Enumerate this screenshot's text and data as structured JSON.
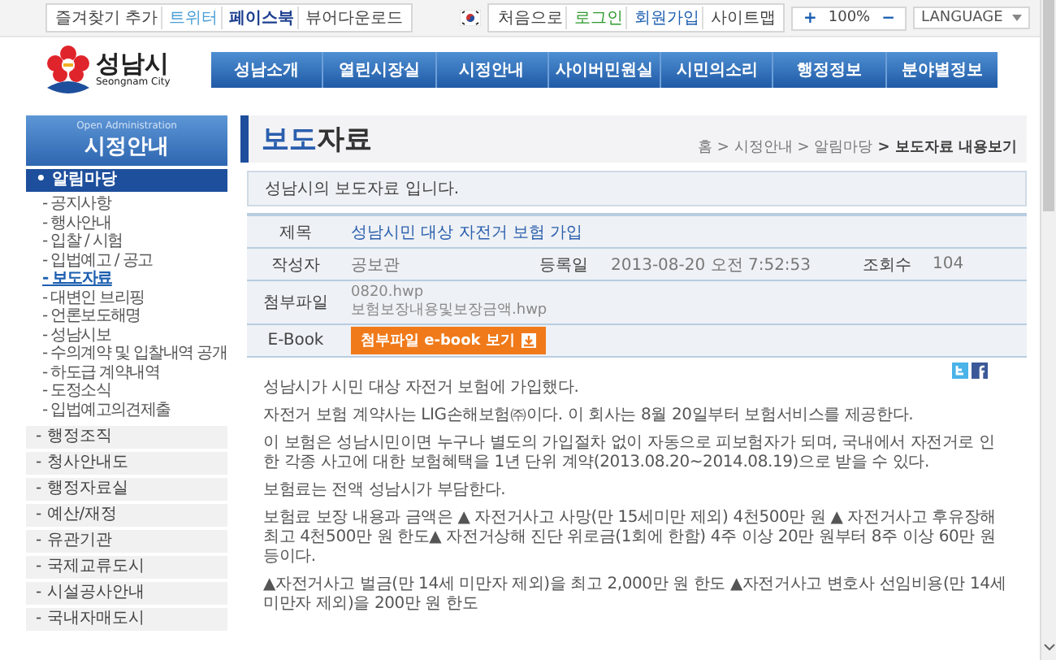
{
  "top_bar": {
    "left_links": [
      {
        "label": "즐겨찾기 추가",
        "kind": "plain"
      },
      {
        "label": "트위터",
        "kind": "twitter"
      },
      {
        "label": "페이스북",
        "kind": "facebook"
      },
      {
        "label": "뷰어다운로드",
        "kind": "plain"
      }
    ],
    "right_links": [
      {
        "label": "처음으로",
        "kind": "plain"
      },
      {
        "label": "로그인",
        "kind": "login"
      },
      {
        "label": "회원가입",
        "kind": "join"
      },
      {
        "label": "사이트맵",
        "kind": "plain"
      }
    ],
    "zoom": {
      "increase": "+",
      "value": "100%",
      "decrease": "−"
    },
    "language": "LANGUAGE"
  },
  "logo": {
    "name": "성남시",
    "subtitle": "Seongnam City"
  },
  "nav": [
    "성남소개",
    "열린시장실",
    "시정안내",
    "사이버민원실",
    "시민의소리",
    "행정정보",
    "분야별정보"
  ],
  "sidebar": {
    "subtitle": "Open Administration",
    "title": "시정안내",
    "items": [
      {
        "label": "• 알림마당",
        "expanded": true,
        "children": [
          {
            "label": "- 공지사항",
            "selected": false
          },
          {
            "label": "- 행사안내",
            "selected": false
          },
          {
            "label": "- 입찰 / 시험",
            "selected": false
          },
          {
            "label": "- 입법예고 / 공고",
            "selected": false
          },
          {
            "label": "- 보도자료",
            "selected": true
          },
          {
            "label": "- 대변인 브리핑",
            "selected": false
          },
          {
            "label": "- 언론보도해명",
            "selected": false
          },
          {
            "label": "- 성남시보",
            "selected": false
          },
          {
            "label": "- 수의계약 및 입찰내역 공개",
            "selected": false
          },
          {
            "label": "- 하도급 계약내역",
            "selected": false
          },
          {
            "label": "- 도정소식",
            "selected": false
          },
          {
            "label": "- 입법예고의견제출",
            "selected": false
          }
        ]
      },
      {
        "label": "- 행정조직",
        "expanded": false
      },
      {
        "label": "- 청사안내도",
        "expanded": false
      },
      {
        "label": "- 행정자료실",
        "expanded": false
      },
      {
        "label": "- 예산/재정",
        "expanded": false
      },
      {
        "label": "- 유관기관",
        "expanded": false
      },
      {
        "label": "- 국제교류도시",
        "expanded": false
      },
      {
        "label": "- 시설공사안내",
        "expanded": false
      },
      {
        "label": "- 국내자매도시",
        "expanded": false
      }
    ]
  },
  "page": {
    "title": "**보도**자료",
    "breadcrumb": [
      "홈",
      "> 시정안내",
      "> 알림마당",
      "> 보도자료 내용보기"
    ],
    "intro": "성남시의 보도자료 입니다.",
    "details": {
      "subject_label": "제목",
      "subject": "성남시민 대상 자전거 보험 가입",
      "author_label": "작성자",
      "author": "공보관",
      "date_label": "등록일",
      "date": "2013-08-20 오전 7:52:53",
      "views_label": "조회수",
      "views": "104",
      "files_label": "첨부파일",
      "files": [
        "0820.hwp",
        "보험보장내용및보장금액.hwp"
      ],
      "ebook_label": "E-Book",
      "ebook_button": "첨부파일 e-book 보기"
    },
    "body": [
      "성남시가 시민 대상 자전거 보험에 가입했다.",
      "자전거 보험 계약사는 LIG손해보험㈜이다. 이 회사는 8월 20일부터 보험서비스를 제공한다.",
      "이 보험은 성남시민이면 누구나 별도의 가입절차 없이 자동으로 피보험자가 되며, 국내에서 자전거로 인한 각종 사고에 대한 보험혜택을 1년 단위 계약(2013.08.20~2014.08.19)으로 받을 수 있다.",
      "보험료는 전액 성남시가 부담한다.",
      "보험료 보장 내용과 금액은 ▲ 자전거사고 사망(만 15세미만 제외) 4천500만 원 ▲ 자전거사고 후유장해 최고 4천500만 원 한도▲ 자전거상해 진단 위로금(1회에 한함) 4주 이상 20만 원부터 8주 이상 60만 원 등이다.",
      "▲자전거사고 벌금(만 14세 미만자 제외)을 최고 2,000만 원 한도 ▲자전거사고 변호사 선임비용(만 14세 미만자 제외)을 200만 원 한도"
    ]
  }
}
